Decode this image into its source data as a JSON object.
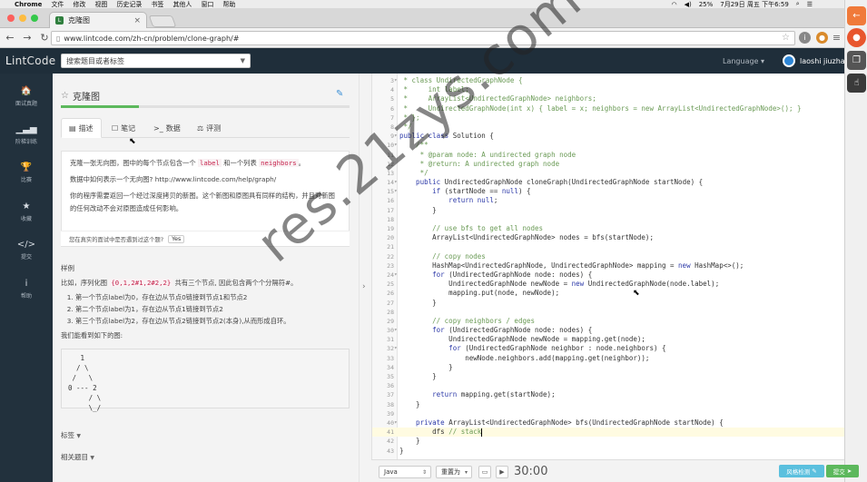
{
  "menubar": {
    "app": "Chrome",
    "items": [
      "文件",
      "修改",
      "视图",
      "历史记录",
      "书签",
      "其他人",
      "窗口",
      "帮助"
    ],
    "battery": "25%",
    "datetime": "7月29日 周五 下午6:59"
  },
  "browser": {
    "tab_title": "克隆图",
    "url": "www.lintcode.com/zh-cn/problem/clone-graph/#"
  },
  "site": {
    "logo_l": "L",
    "logo_rest": "intCode",
    "search_placeholder": "搜索题目或者标签",
    "language_label": "Language",
    "username": "laoshi jiuzha"
  },
  "leftnav": [
    {
      "icon": "home-icon",
      "glyph": "🏠",
      "label": "面试真题"
    },
    {
      "icon": "bar-chart-icon",
      "glyph": "▁▃▅",
      "label": "阶梯训练"
    },
    {
      "icon": "trophy-icon",
      "glyph": "🏆",
      "label": "比赛"
    },
    {
      "icon": "star-icon",
      "glyph": "★",
      "label": "收藏"
    },
    {
      "icon": "code-icon",
      "glyph": "</>",
      "label": "提交"
    },
    {
      "icon": "info-icon",
      "glyph": "i",
      "label": "帮助"
    }
  ],
  "problem": {
    "title": "克隆图",
    "progress_fraction": 0.27,
    "tabs": [
      {
        "icon": "doc-icon",
        "glyph": "▤",
        "label": "描述"
      },
      {
        "icon": "note-icon",
        "glyph": "☐",
        "label": "笔记"
      },
      {
        "icon": "terminal-icon",
        "glyph": ">_",
        "label": "数据"
      },
      {
        "icon": "scale-icon",
        "glyph": "⚖",
        "label": "评测"
      }
    ],
    "desc_p1_a": "克隆一张无向图，图中的每个节点包含一个 ",
    "desc_p1_code1": "label",
    "desc_p1_b": " 和一个列表 ",
    "desc_p1_code2": "neighbors",
    "desc_p1_c": "。",
    "desc_p2": "数据中如何表示一个无向图? http://www.lintcode.com/help/graph/",
    "desc_p3": "你的程序需要返回一个经过深度拷贝的新图。这个新图和原图具有同样的结构，并且对新图的任何改动不会对原图造成任何影响。",
    "interview_question": "您在真实的面试中是否遇到过这个题?",
    "yes_label": "Yes",
    "example_heading": "样例",
    "example_intro_a": "比如，序列化图 ",
    "example_intro_code": "{0,1,2#1,2#2,2}",
    "example_intro_b": " 共有三个节点, 因此包含两个个分隔符#。",
    "example_items": [
      "第一个节点label为0，存在边从节点0链接到节点1和节点2",
      "第二个节点label为1，存在边从节点1链接到节点2",
      "第三个节点label为2，存在边从节点2链接到节点2(本身),从而形成自环。"
    ],
    "example_outro": "我们能看到如下的图:",
    "graph_ascii": "   1\n  / \\\n /   \\\n0 --- 2\n     / \\\n     \\_/",
    "tags_label": "标签",
    "related_label": "相关题目"
  },
  "editor": {
    "lines": [
      {
        "n": "3",
        "fold": "▾",
        "segs": [
          [
            "c",
            " * class UndirectedGraphNode {"
          ]
        ]
      },
      {
        "n": "4",
        "fold": "",
        "segs": [
          [
            "c",
            " *     int label;"
          ]
        ]
      },
      {
        "n": "5",
        "fold": "",
        "segs": [
          [
            "c",
            " *     ArrayList<UndirectedGraphNode> neighbors;"
          ]
        ]
      },
      {
        "n": "6",
        "fold": "",
        "segs": [
          [
            "c",
            " *     UndirectedGraphNode(int x) { label = x; neighbors = new ArrayList<UndirectedGraphNode>(); }"
          ]
        ]
      },
      {
        "n": "7",
        "fold": "",
        "segs": [
          [
            "c",
            " * };"
          ]
        ]
      },
      {
        "n": "8",
        "fold": "",
        "segs": [
          [
            "c",
            " */"
          ]
        ]
      },
      {
        "n": "9",
        "fold": "▾",
        "segs": [
          [
            "k",
            "public class "
          ],
          [
            "t",
            "Solution {"
          ]
        ]
      },
      {
        "n": "10",
        "fold": "▾",
        "segs": [
          [
            "c",
            "    /**"
          ]
        ]
      },
      {
        "n": "11",
        "fold": "",
        "segs": [
          [
            "c",
            "     * @param node: A undirected graph node"
          ]
        ]
      },
      {
        "n": "12",
        "fold": "",
        "segs": [
          [
            "c",
            "     * @return: A undirected graph node"
          ]
        ]
      },
      {
        "n": "13",
        "fold": "",
        "segs": [
          [
            "c",
            "     */"
          ]
        ]
      },
      {
        "n": "14",
        "fold": "▾",
        "segs": [
          [
            "k",
            "    public "
          ],
          [
            "t",
            "UndirectedGraphNode cloneGraph(UndirectedGraphNode startNode) {"
          ]
        ]
      },
      {
        "n": "15",
        "fold": "▾",
        "segs": [
          [
            "k",
            "        if "
          ],
          [
            "t",
            "(startNode == "
          ],
          [
            "k",
            "null"
          ],
          [
            "t",
            ") {"
          ]
        ]
      },
      {
        "n": "16",
        "fold": "",
        "segs": [
          [
            "k",
            "            return null"
          ],
          [
            "t",
            ";"
          ]
        ]
      },
      {
        "n": "17",
        "fold": "",
        "segs": [
          [
            "t",
            "        }"
          ]
        ]
      },
      {
        "n": "18",
        "fold": "",
        "segs": [
          [
            "t",
            ""
          ]
        ]
      },
      {
        "n": "19",
        "fold": "",
        "segs": [
          [
            "c",
            "        // use bfs to get all nodes"
          ]
        ]
      },
      {
        "n": "20",
        "fold": "",
        "segs": [
          [
            "t",
            "        ArrayList<UndirectedGraphNode> nodes = bfs(startNode);"
          ]
        ]
      },
      {
        "n": "21",
        "fold": "",
        "segs": [
          [
            "t",
            ""
          ]
        ]
      },
      {
        "n": "22",
        "fold": "",
        "segs": [
          [
            "c",
            "        // copy nodes"
          ]
        ]
      },
      {
        "n": "23",
        "fold": "",
        "segs": [
          [
            "t",
            "        HashMap<UndirectedGraphNode, UndirectedGraphNode> mapping = "
          ],
          [
            "k",
            "new "
          ],
          [
            "t",
            "HashMap<>();"
          ]
        ]
      },
      {
        "n": "24",
        "fold": "▾",
        "segs": [
          [
            "k",
            "        for "
          ],
          [
            "t",
            "(UndirectedGraphNode node: nodes) {"
          ]
        ]
      },
      {
        "n": "25",
        "fold": "",
        "segs": [
          [
            "t",
            "            UndirectedGraphNode newNode = "
          ],
          [
            "k",
            "new "
          ],
          [
            "t",
            "UndirectedGraphNode(node.label);"
          ]
        ]
      },
      {
        "n": "26",
        "fold": "",
        "segs": [
          [
            "t",
            "            mapping.put(node, newNode);"
          ]
        ]
      },
      {
        "n": "27",
        "fold": "",
        "segs": [
          [
            "t",
            "        }"
          ]
        ]
      },
      {
        "n": "28",
        "fold": "",
        "segs": [
          [
            "t",
            ""
          ]
        ]
      },
      {
        "n": "29",
        "fold": "",
        "segs": [
          [
            "c",
            "        // copy neighbors / edges"
          ]
        ]
      },
      {
        "n": "30",
        "fold": "▾",
        "segs": [
          [
            "k",
            "        for "
          ],
          [
            "t",
            "(UndirectedGraphNode node: nodes) {"
          ]
        ]
      },
      {
        "n": "31",
        "fold": "",
        "segs": [
          [
            "t",
            "            UndirectedGraphNode newNode = mapping.get(node);"
          ]
        ]
      },
      {
        "n": "32",
        "fold": "▾",
        "segs": [
          [
            "k",
            "            for "
          ],
          [
            "t",
            "(UndirectedGraphNode neighbor : node.neighbors) {"
          ]
        ]
      },
      {
        "n": "33",
        "fold": "",
        "segs": [
          [
            "t",
            "                newNode.neighbors.add(mapping.get(neighbor));"
          ]
        ]
      },
      {
        "n": "34",
        "fold": "",
        "segs": [
          [
            "t",
            "            }"
          ]
        ]
      },
      {
        "n": "35",
        "fold": "",
        "segs": [
          [
            "t",
            "        }"
          ]
        ]
      },
      {
        "n": "36",
        "fold": "",
        "segs": [
          [
            "t",
            ""
          ]
        ]
      },
      {
        "n": "37",
        "fold": "",
        "segs": [
          [
            "k",
            "        return "
          ],
          [
            "t",
            "mapping.get(startNode);"
          ]
        ]
      },
      {
        "n": "38",
        "fold": "",
        "segs": [
          [
            "t",
            "    }"
          ]
        ]
      },
      {
        "n": "39",
        "fold": "",
        "segs": [
          [
            "t",
            ""
          ]
        ]
      },
      {
        "n": "40",
        "fold": "▾",
        "segs": [
          [
            "k",
            "    private "
          ],
          [
            "t",
            "ArrayList<UndirectedGraphNode> bfs(UndirectedGraphNode startNode) {"
          ]
        ]
      },
      {
        "n": "41",
        "fold": "",
        "segs": [
          [
            "t",
            "        dfs "
          ],
          [
            "c",
            "// stack"
          ]
        ],
        "active": true
      },
      {
        "n": "42",
        "fold": "",
        "segs": [
          [
            "t",
            "    }"
          ]
        ]
      },
      {
        "n": "43",
        "fold": "",
        "segs": [
          [
            "t",
            "}"
          ]
        ]
      }
    ],
    "language": "Java",
    "reset_label": "重置为",
    "timer": "30:00",
    "check_label": "风格检测",
    "submit_label": "提交"
  },
  "watermark": "res.21zys.com"
}
